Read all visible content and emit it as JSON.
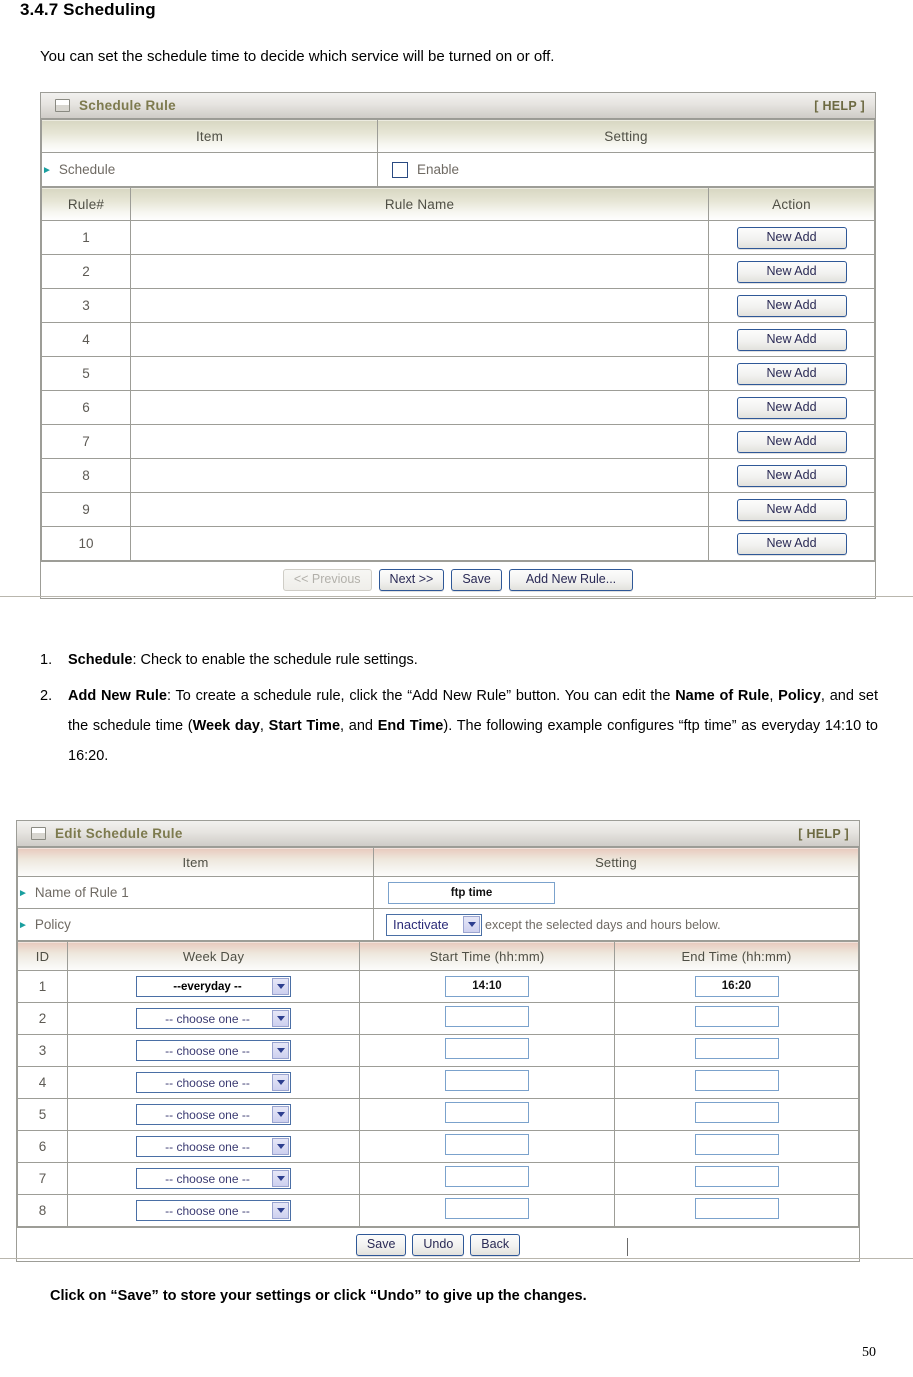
{
  "document": {
    "heading": "3.4.7 Scheduling",
    "intro": "You can set the schedule time to decide which service will be turned on or off.",
    "closing": "Click on “Save” to store your settings or click “Undo” to give up the changes.",
    "page_number": "50"
  },
  "schedule_panel": {
    "title": "Schedule Rule",
    "help_label": "[ HELP ]",
    "icon": "window-icon",
    "columns": {
      "item": "Item",
      "setting": "Setting"
    },
    "schedule_row": {
      "label": "Schedule",
      "checkbox_label": "Enable",
      "checked": false
    },
    "rule_columns": {
      "rule_num": "Rule#",
      "rule_name": "Rule Name",
      "action": "Action"
    },
    "rules": [
      {
        "id": "1",
        "name": "",
        "action": "New Add"
      },
      {
        "id": "2",
        "name": "",
        "action": "New Add"
      },
      {
        "id": "3",
        "name": "",
        "action": "New Add"
      },
      {
        "id": "4",
        "name": "",
        "action": "New Add"
      },
      {
        "id": "5",
        "name": "",
        "action": "New Add"
      },
      {
        "id": "6",
        "name": "",
        "action": "New Add"
      },
      {
        "id": "7",
        "name": "",
        "action": "New Add"
      },
      {
        "id": "8",
        "name": "",
        "action": "New Add"
      },
      {
        "id": "9",
        "name": "",
        "action": "New Add"
      },
      {
        "id": "10",
        "name": "",
        "action": "New Add"
      }
    ],
    "buttons": {
      "previous": "<< Previous",
      "next": "Next >>",
      "save": "Save",
      "add_new_rule": "Add New Rule..."
    }
  },
  "list_items": [
    {
      "num": "1.",
      "html": "<b>Schedule</b>: Check to enable the schedule rule settings."
    },
    {
      "num": "2.",
      "html": "<b>Add New Rule</b>: To create a schedule rule, click the “Add New Rule” button. You can edit the <b>Name of Rule</b>, <b>Policy</b>, and set the schedule time (<b>Week day</b>, <b>Start Time</b>, and <b>End Time</b>). The following example configures “ftp time” as everyday 14:10 to 16:20."
    }
  ],
  "edit_panel": {
    "title": "Edit Schedule Rule",
    "help_label": "[ HELP ]",
    "icon": "window-icon",
    "columns": {
      "item": "Item",
      "setting": "Setting"
    },
    "name_row": {
      "label": "Name of Rule 1",
      "value": "ftp time"
    },
    "policy_row": {
      "label": "Policy",
      "selected": "Inactivate",
      "note": "except the selected days and hours below."
    },
    "schedule_columns": {
      "id": "ID",
      "week_day": "Week Day",
      "start_time": "Start Time (hh:mm)",
      "end_time": "End Time (hh:mm)"
    },
    "schedule_rows": [
      {
        "id": "1",
        "week_day": "--everyday      --",
        "selected": true,
        "start_time": "14:10",
        "end_time": "16:20"
      },
      {
        "id": "2",
        "week_day": "-- choose one --",
        "selected": false,
        "start_time": "",
        "end_time": ""
      },
      {
        "id": "3",
        "week_day": "-- choose one --",
        "selected": false,
        "start_time": "",
        "end_time": ""
      },
      {
        "id": "4",
        "week_day": "-- choose one --",
        "selected": false,
        "start_time": "",
        "end_time": ""
      },
      {
        "id": "5",
        "week_day": "-- choose one --",
        "selected": false,
        "start_time": "",
        "end_time": ""
      },
      {
        "id": "6",
        "week_day": "-- choose one --",
        "selected": false,
        "start_time": "",
        "end_time": ""
      },
      {
        "id": "7",
        "week_day": "-- choose one --",
        "selected": false,
        "start_time": "",
        "end_time": ""
      },
      {
        "id": "8",
        "week_day": "-- choose one --",
        "selected": false,
        "start_time": "",
        "end_time": ""
      }
    ],
    "buttons": {
      "save": "Save",
      "undo": "Undo",
      "back": "Back"
    }
  },
  "colors": {
    "panel_title_text": "#7d7a4e",
    "table_header_olive": "#d8d7c2",
    "table_header_pink": "#e8c9bd",
    "arrow_marker": "#1a9f9f",
    "button_border": "#2f5897",
    "input_border": "#7ba2cc"
  }
}
